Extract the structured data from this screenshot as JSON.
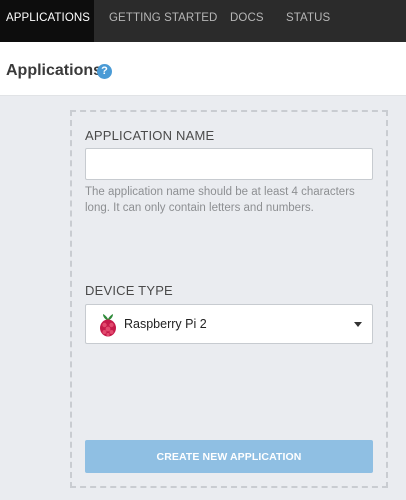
{
  "nav": {
    "items": [
      {
        "label": "APPLICATIONS",
        "active": true
      },
      {
        "label": "GETTING STARTED",
        "active": false
      },
      {
        "label": "DOCS",
        "active": false
      },
      {
        "label": "STATUS",
        "active": false
      }
    ]
  },
  "header": {
    "title": "Applications",
    "help_icon": "?"
  },
  "form": {
    "app_name_label": "APPLICATION NAME",
    "app_name_value": "",
    "app_name_help": "The application name should be at least 4 characters long. It can only contain letters and numbers.",
    "device_type_label": "DEVICE TYPE",
    "device_type_value": "Raspberry Pi 2",
    "device_type_icon": "raspberry-pi-icon",
    "submit_label": "CREATE NEW APPLICATION"
  },
  "colors": {
    "nav_bg": "#2b2b2b",
    "nav_active_bg": "#0d0d0d",
    "accent": "#4a9bd6",
    "button_disabled": "#8fbfe3",
    "page_bg": "#eaecf0"
  }
}
